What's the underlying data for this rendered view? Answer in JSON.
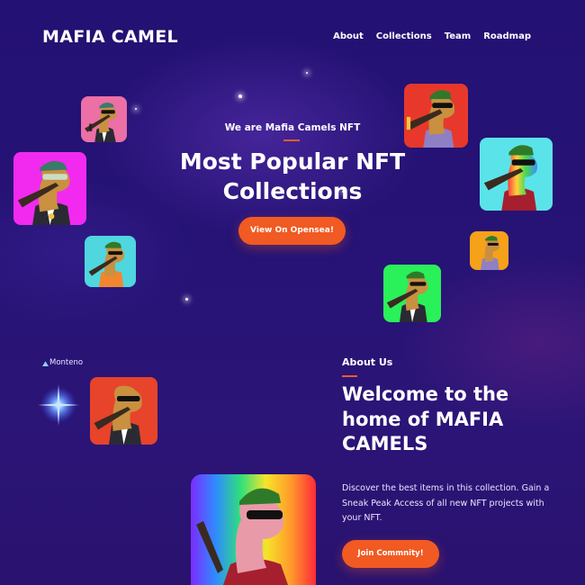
{
  "header": {
    "brand": "MAFIA CAMEL",
    "nav": [
      "About",
      "Collections",
      "Team",
      "Roadmap"
    ]
  },
  "hero": {
    "kicker": "We are Mafia Camels NFT",
    "title": "Most Popular NFT Collections",
    "cta_label": "View On Opensea!"
  },
  "about": {
    "logo_alt": "Monteno",
    "kicker": "About Us",
    "title": "Welcome to the home of MAFIA CAMELS",
    "text": "Discover the best items in this collection. Gain a Sneak Peak Access of all new NFT projects with your NFT.",
    "cta_label": "Join Commnity!"
  },
  "colors": {
    "accent": "#f15a22",
    "background": "#251274"
  },
  "nft_cards": [
    {
      "name": "camel-pink",
      "bg": "#ec6fa6"
    },
    {
      "name": "camel-magenta",
      "bg": "#f22af0"
    },
    {
      "name": "camel-cyan-orange",
      "bg": "#4fd6df"
    },
    {
      "name": "camel-red",
      "bg": "#e8382b"
    },
    {
      "name": "camel-cyan-rainbow",
      "bg": "#5be3ea"
    },
    {
      "name": "camel-orange",
      "bg": "#f5a11a"
    },
    {
      "name": "camel-green",
      "bg": "#2af05a"
    },
    {
      "name": "camel-red-about",
      "bg": "#e8432b"
    },
    {
      "name": "camel-rainbow",
      "bg": "rainbow"
    }
  ]
}
